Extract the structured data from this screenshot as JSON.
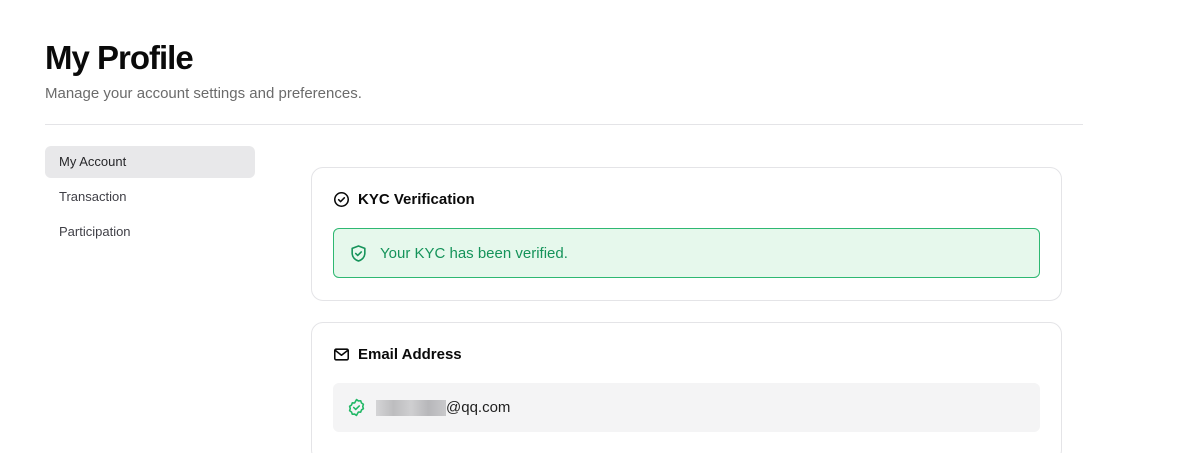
{
  "page": {
    "title": "My Profile",
    "subtitle": "Manage your account settings and preferences."
  },
  "sidebar": {
    "items": [
      {
        "label": "My Account",
        "active": true
      },
      {
        "label": "Transaction",
        "active": false
      },
      {
        "label": "Participation",
        "active": false
      }
    ]
  },
  "kyc": {
    "title": "KYC Verification",
    "icon": "check-circle-icon",
    "status_text": "Your KYC has been verified.",
    "status_icon": "shield-check-icon"
  },
  "email": {
    "title": "Email Address",
    "icon": "mail-icon",
    "verified_icon": "badge-check-icon",
    "masked": true,
    "domain": "@qq.com"
  },
  "colors": {
    "success_text": "#15935a",
    "success_border": "#2eb872",
    "success_bg": "#e6f8ec",
    "active_nav_bg": "#e8e8ea"
  }
}
